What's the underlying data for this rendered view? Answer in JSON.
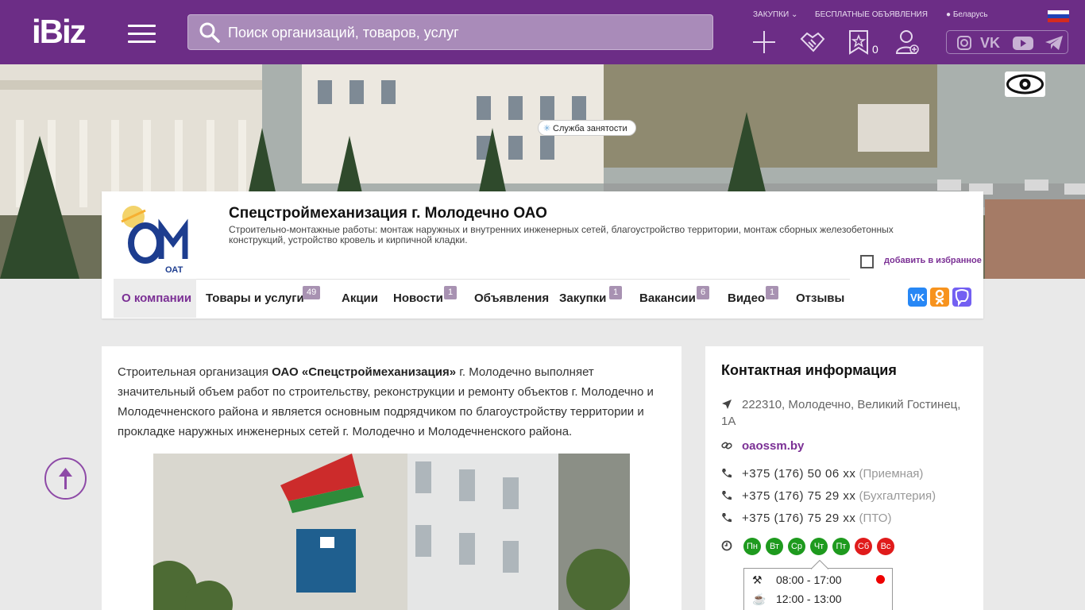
{
  "header": {
    "logo": "iBiz",
    "search_placeholder": "Поиск организаций, товаров, услуг",
    "links": {
      "zakupki": "Закупки",
      "free_ads": "Бесплатные объявления",
      "region": "Беларусь"
    },
    "favorites_count": "0",
    "social": [
      "instagram-icon",
      "vk-icon",
      "youtube-icon",
      "telegram-icon"
    ],
    "colors": {
      "brand": "#6c2d86",
      "accent": "#7b3095"
    }
  },
  "company": {
    "title": "Спецстроймеханизация г. Молодечно ОАО",
    "description": "Строительно-монтажные работы: монтаж наружных и внутренних инженерных сетей, благоустройство территории, монтаж сборных железобетонных конструкций, устройство кровель и кирпичной кладки.",
    "favorite_label": "добавить в избранное",
    "logo_text": "ОАТ"
  },
  "nav": {
    "tabs": [
      {
        "label": "О компании",
        "badge": ""
      },
      {
        "label": "Товары и услуги",
        "badge": "49"
      },
      {
        "label": "Акции",
        "badge": ""
      },
      {
        "label": "Новости",
        "badge": "1"
      },
      {
        "label": "Объявления",
        "badge": ""
      },
      {
        "label": "Закупки",
        "badge": "1"
      },
      {
        "label": "Вакансии",
        "badge": "6"
      },
      {
        "label": "Видео",
        "badge": "1"
      },
      {
        "label": "Отзывы",
        "badge": ""
      }
    ],
    "sub_tag": "Служба занятости"
  },
  "article": {
    "intro_p1": "Строительная организация ",
    "intro_bold": "ОАО «Спецстроймеханизация»",
    "intro_p2": " г. Молодечно выполняет значительный объем работ по строительству, реконструкции и ремонту объектов г. Молодечно и Молодечненского района и является основным подрядчиком по благоустройству территории и прокладке наружных инженерных сетей г. Молодечно и Молодечненского района."
  },
  "contacts": {
    "title": "Контактная информация",
    "address_line1": "222310, Молодечно, Великий Гостинец,",
    "address_line2": "1А",
    "website": "oaossm.by",
    "phones": [
      {
        "number": "+375 (176) 50 06 xx",
        "note": "(Приемная)"
      },
      {
        "number": "+375 (176) 75 29 xx",
        "note": "(Бухгалтерия)"
      },
      {
        "number": "+375 (176) 75 29 xx",
        "note": "(ПТО)"
      }
    ],
    "days": [
      {
        "label": "Пн",
        "color": "#1e9a1e"
      },
      {
        "label": "Вт",
        "color": "#1e9a1e"
      },
      {
        "label": "Ср",
        "color": "#1e9a1e"
      },
      {
        "label": "Чт",
        "color": "#1e9a1e"
      },
      {
        "label": "Пт",
        "color": "#1e9a1e"
      },
      {
        "label": "Сб",
        "color": "#e01b1b"
      },
      {
        "label": "Вс",
        "color": "#e01b1b"
      }
    ],
    "work_hours": "08:00 - 17:00",
    "lunch_hours": "12:00 - 13:00"
  }
}
